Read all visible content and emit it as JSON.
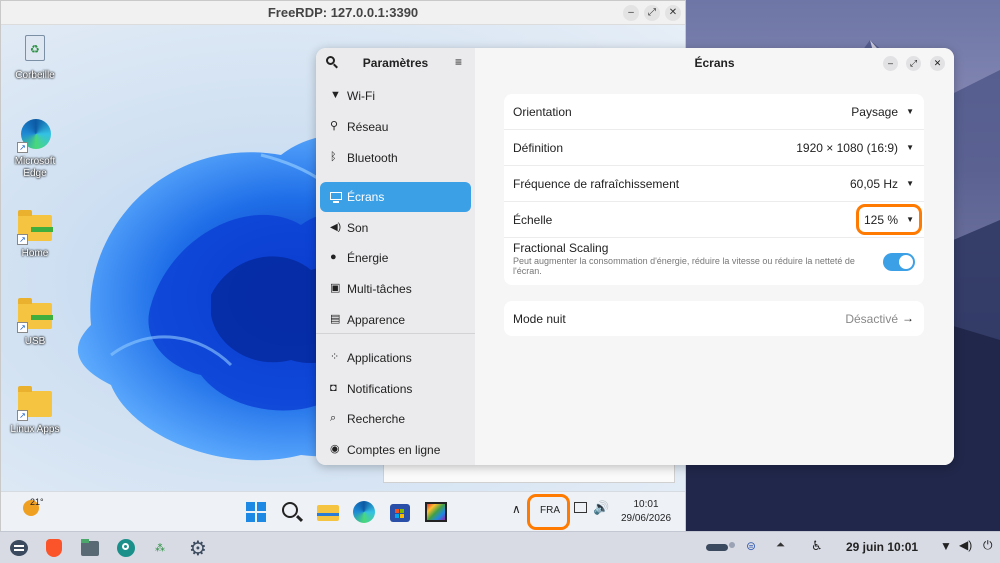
{
  "rdp_window": {
    "title": "FreeRDP: 127.0.0.1:3390"
  },
  "desktop_icons": [
    {
      "label": "Corbeille"
    },
    {
      "label": "Microsoft Edge"
    },
    {
      "label": "Home"
    },
    {
      "label": "USB"
    },
    {
      "label": "Linux Apps"
    }
  ],
  "settings": {
    "sidebar_title": "Paramètres",
    "content_title": "Écrans",
    "sidebar_items": [
      {
        "label": "Wi-Fi",
        "icon": "wifi-icon"
      },
      {
        "label": "Réseau",
        "icon": "network-icon"
      },
      {
        "label": "Bluetooth",
        "icon": "bluetooth-icon"
      },
      {
        "label": "Écrans",
        "icon": "display-icon",
        "active": true
      },
      {
        "label": "Son",
        "icon": "sound-icon"
      },
      {
        "label": "Énergie",
        "icon": "power-icon"
      },
      {
        "label": "Multi-tâches",
        "icon": "multitasking-icon"
      },
      {
        "label": "Apparence",
        "icon": "appearance-icon"
      },
      {
        "label": "Applications",
        "icon": "applications-icon"
      },
      {
        "label": "Notifications",
        "icon": "bell-icon"
      },
      {
        "label": "Recherche",
        "icon": "search-icon"
      },
      {
        "label": "Comptes en ligne",
        "icon": "online-accounts-icon"
      }
    ],
    "display": {
      "orientation_label": "Orientation",
      "orientation_value": "Paysage",
      "resolution_label": "Définition",
      "resolution_value": "1920 × 1080 (16:9)",
      "refresh_label": "Fréquence de rafraîchissement",
      "refresh_value": "60,05 Hz",
      "scale_label": "Échelle",
      "scale_value": "125 %",
      "fractional_label": "Fractional Scaling",
      "fractional_desc": "Peut augmenter la consommation d'énergie, réduire la vitesse ou réduire la netteté de l'écran.",
      "fractional_enabled": true
    },
    "night_mode": {
      "label": "Mode nuit",
      "value": "Désactivé"
    }
  },
  "win_taskbar": {
    "weather_temp": "21°",
    "language": "FRA",
    "time": "10:01",
    "date": "29/06/2026"
  },
  "linux_panel": {
    "date_time": "29 juin  10:01"
  },
  "colors": {
    "accent": "#3ca0e6",
    "highlight": "#ff7a00"
  }
}
